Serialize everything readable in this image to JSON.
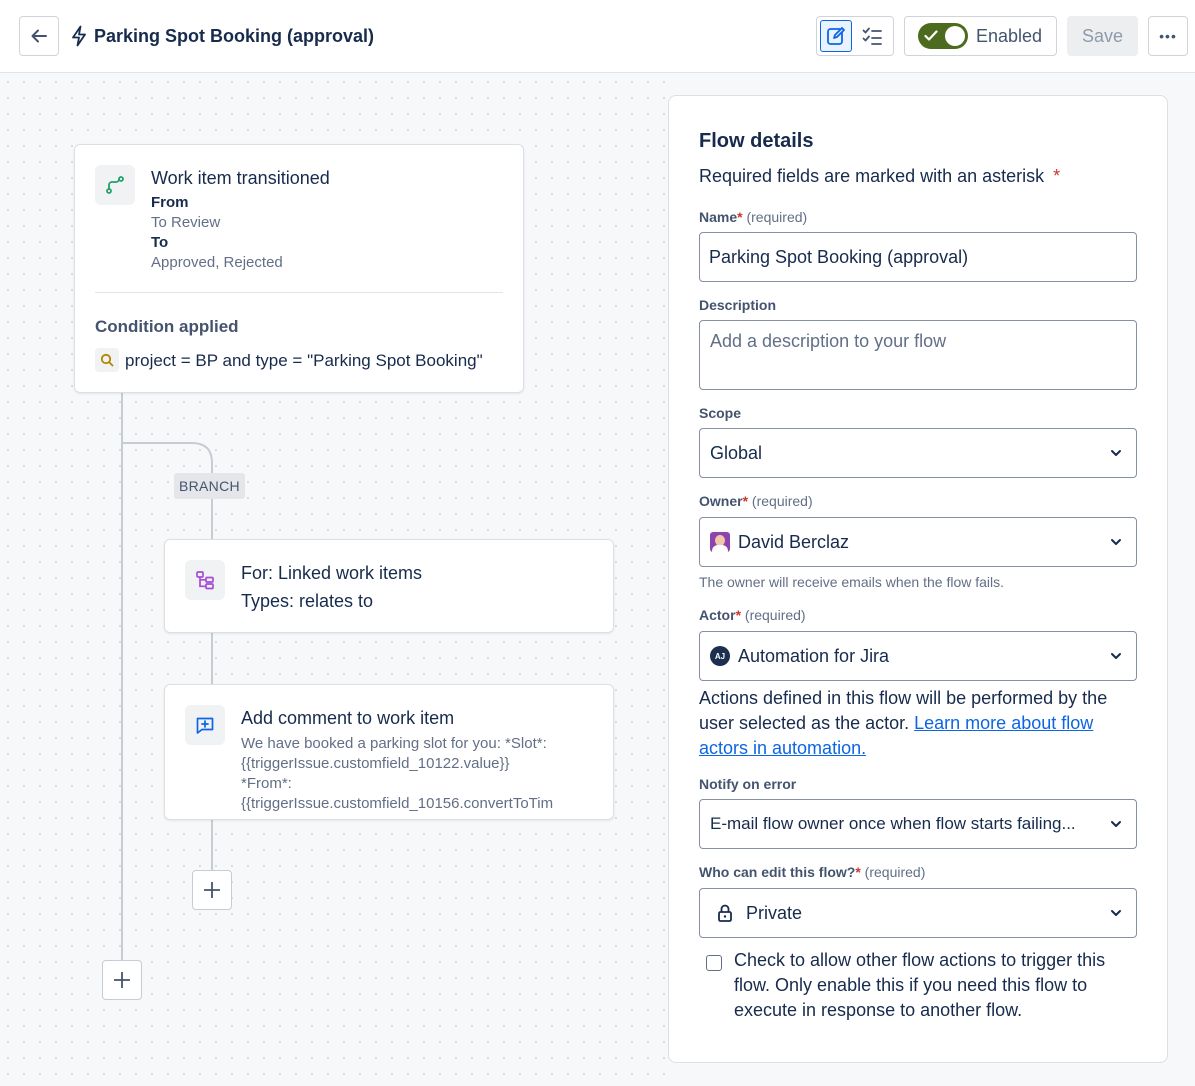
{
  "header": {
    "title": "Parking Spot Booking (approval)",
    "enabled_label": "Enabled",
    "save_label": "Save",
    "more_label": "•••"
  },
  "trigger": {
    "title": "Work item transitioned",
    "from_label": "From",
    "from_value": "To Review",
    "to_label": "To",
    "to_value": "Approved, Rejected",
    "condition_heading": "Condition applied",
    "condition_query": "project = BP and type = \"Parking Spot Booking\""
  },
  "branch": {
    "label": "BRANCH",
    "card_title": "For: Linked work items",
    "card_subtitle": "Types: relates to"
  },
  "comment_action": {
    "title": "Add comment to work item",
    "body_lines": [
      "We have booked a parking slot for you: *Slot*:",
      "{{triggerIssue.customfield_10122.value}}",
      "*From*:",
      "{{triggerIssue.customfield_10156.convertToTim"
    ]
  },
  "panel": {
    "heading": "Flow details",
    "required_note": "Required fields are marked with an asterisk",
    "asterisk": "*",
    "required_tag": "(required)",
    "name_label": "Name",
    "name_value": "Parking Spot Booking (approval)",
    "description_label": "Description",
    "description_placeholder": "Add a description to your flow",
    "scope_label": "Scope",
    "scope_value": "Global",
    "owner_label": "Owner",
    "owner_value": "David Berclaz",
    "owner_helper": "The owner will receive emails when the flow fails.",
    "actor_label": "Actor",
    "actor_value": "Automation for Jira",
    "actor_avatar_text": "AJ",
    "actor_desc_line1": "Actions defined in this flow will be performed by the",
    "actor_desc_line2": "user selected as the actor.",
    "actor_link_line1": "Learn more about flow",
    "actor_link_line2": "actors in automation.",
    "notify_label": "Notify on error",
    "notify_value": "E-mail flow owner once when flow starts failing...",
    "editors_label": "Who can edit this flow?",
    "editors_value": "Private",
    "checkbox_line1": "Check to allow other flow actions to trigger this",
    "checkbox_line2": "flow. Only enable this if you need this flow to",
    "checkbox_line3": "execute in response to another flow."
  },
  "colors": {
    "toggle_on": "#4c6b1f",
    "link": "#0c66e4",
    "required": "#c9372c",
    "trigger_icon": "#22a06b",
    "branch_icon": "#a54bd6",
    "comment_icon": "#0c66e4",
    "condition_icon": "#b38600"
  }
}
